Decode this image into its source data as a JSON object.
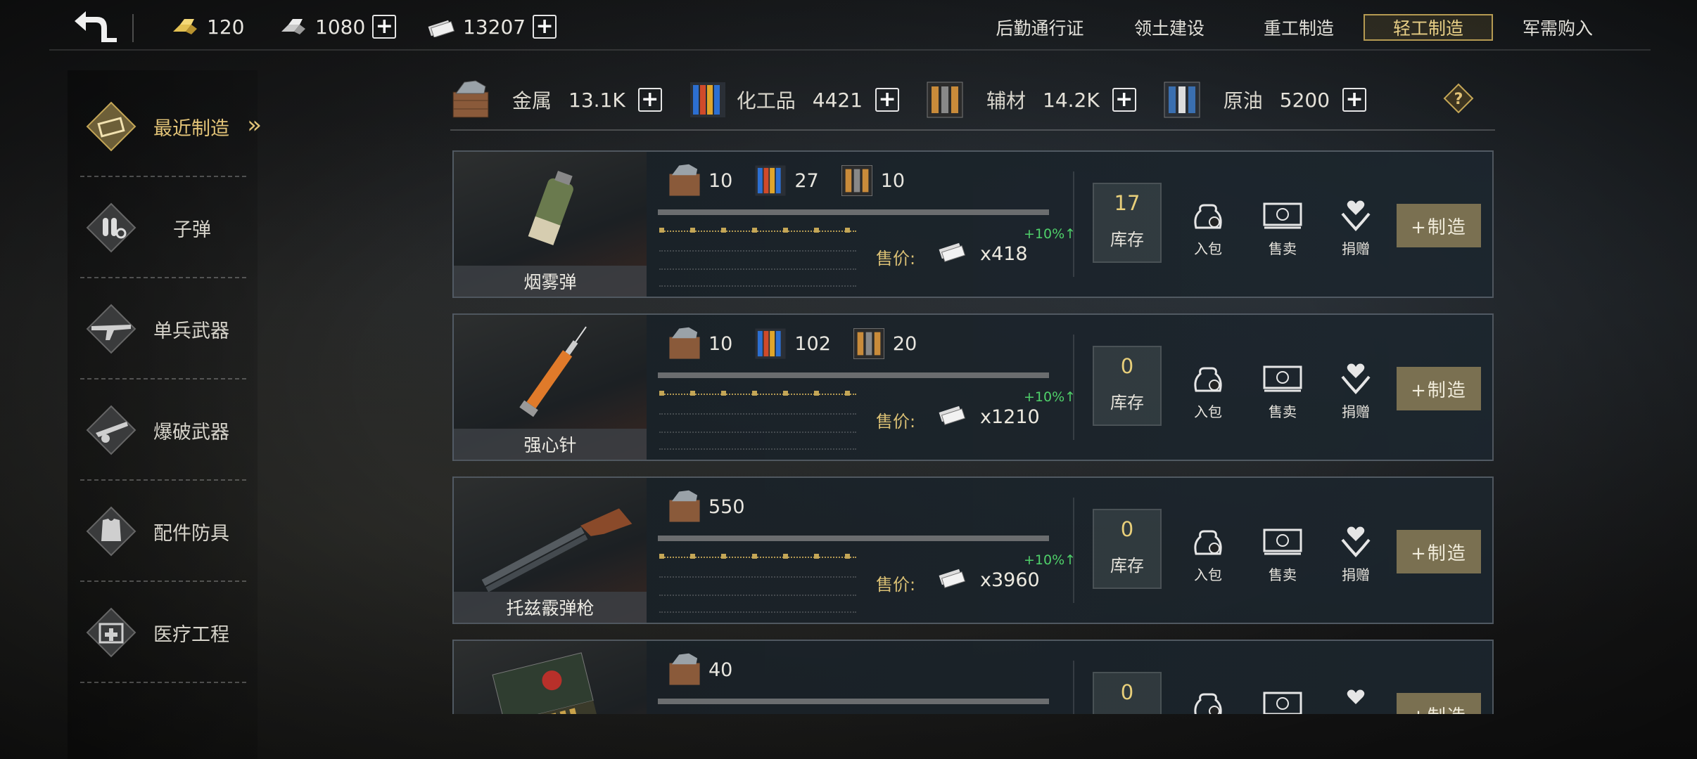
{
  "currencies": [
    {
      "name": "gold-bars",
      "value": "120"
    },
    {
      "name": "silver-bars",
      "value": "1080"
    },
    {
      "name": "banknotes",
      "value": "13207"
    }
  ],
  "top_tabs": [
    {
      "label": "后勤通行证",
      "active": false
    },
    {
      "label": "领土建设",
      "active": false
    },
    {
      "label": "重工制造",
      "active": false
    },
    {
      "label": "轻工制造",
      "active": true
    },
    {
      "label": "军需购入",
      "active": false
    }
  ],
  "sidebar": {
    "items": [
      {
        "label": "最近制造",
        "icon": "crate-icon",
        "active": true
      },
      {
        "label": "子弹",
        "icon": "bullet-icon",
        "active": false
      },
      {
        "label": "单兵武器",
        "icon": "rifle-icon",
        "active": false
      },
      {
        "label": "爆破武器",
        "icon": "explosive-icon",
        "active": false
      },
      {
        "label": "配件防具",
        "icon": "armor-icon",
        "active": false
      },
      {
        "label": "医疗工程",
        "icon": "medkit-icon",
        "active": false
      }
    ]
  },
  "resources": [
    {
      "name": "金属",
      "value": "13.1K",
      "icon": "metal-crate-icon"
    },
    {
      "name": "化工品",
      "value": "4421",
      "icon": "chemical-crate-icon"
    },
    {
      "name": "辅材",
      "value": "14.2K",
      "icon": "aux-crate-icon"
    },
    {
      "name": "原油",
      "value": "5200",
      "icon": "oil-crate-icon"
    }
  ],
  "labels": {
    "price": "售价:",
    "stock": "库存",
    "stash": "入包",
    "sell": "售卖",
    "donate": "捐赠",
    "make": "+制造",
    "bonus": "+10%"
  },
  "items": [
    {
      "name": "烟雾弹",
      "materials": [
        {
          "icon": "metal",
          "qty": "10"
        },
        {
          "icon": "chemical",
          "qty": "27"
        },
        {
          "icon": "aux",
          "qty": "10"
        }
      ],
      "price": "x418",
      "stock": "17",
      "thumb": "smoke-grenade"
    },
    {
      "name": "强心针",
      "materials": [
        {
          "icon": "metal",
          "qty": "10"
        },
        {
          "icon": "chemical",
          "qty": "102"
        },
        {
          "icon": "aux",
          "qty": "20"
        }
      ],
      "price": "x1210",
      "stock": "0",
      "thumb": "syringe"
    },
    {
      "name": "托兹霰弹枪",
      "materials": [
        {
          "icon": "metal",
          "qty": "550"
        }
      ],
      "price": "x3960",
      "stock": "0",
      "thumb": "shotgun"
    },
    {
      "name": "",
      "materials": [
        {
          "icon": "metal",
          "qty": "40"
        }
      ],
      "price": "",
      "stock": "0",
      "thumb": "ammo-box"
    }
  ],
  "colors": {
    "accent": "#e2c377",
    "bonus": "#4fd06a",
    "make_button": "#7a7051"
  }
}
